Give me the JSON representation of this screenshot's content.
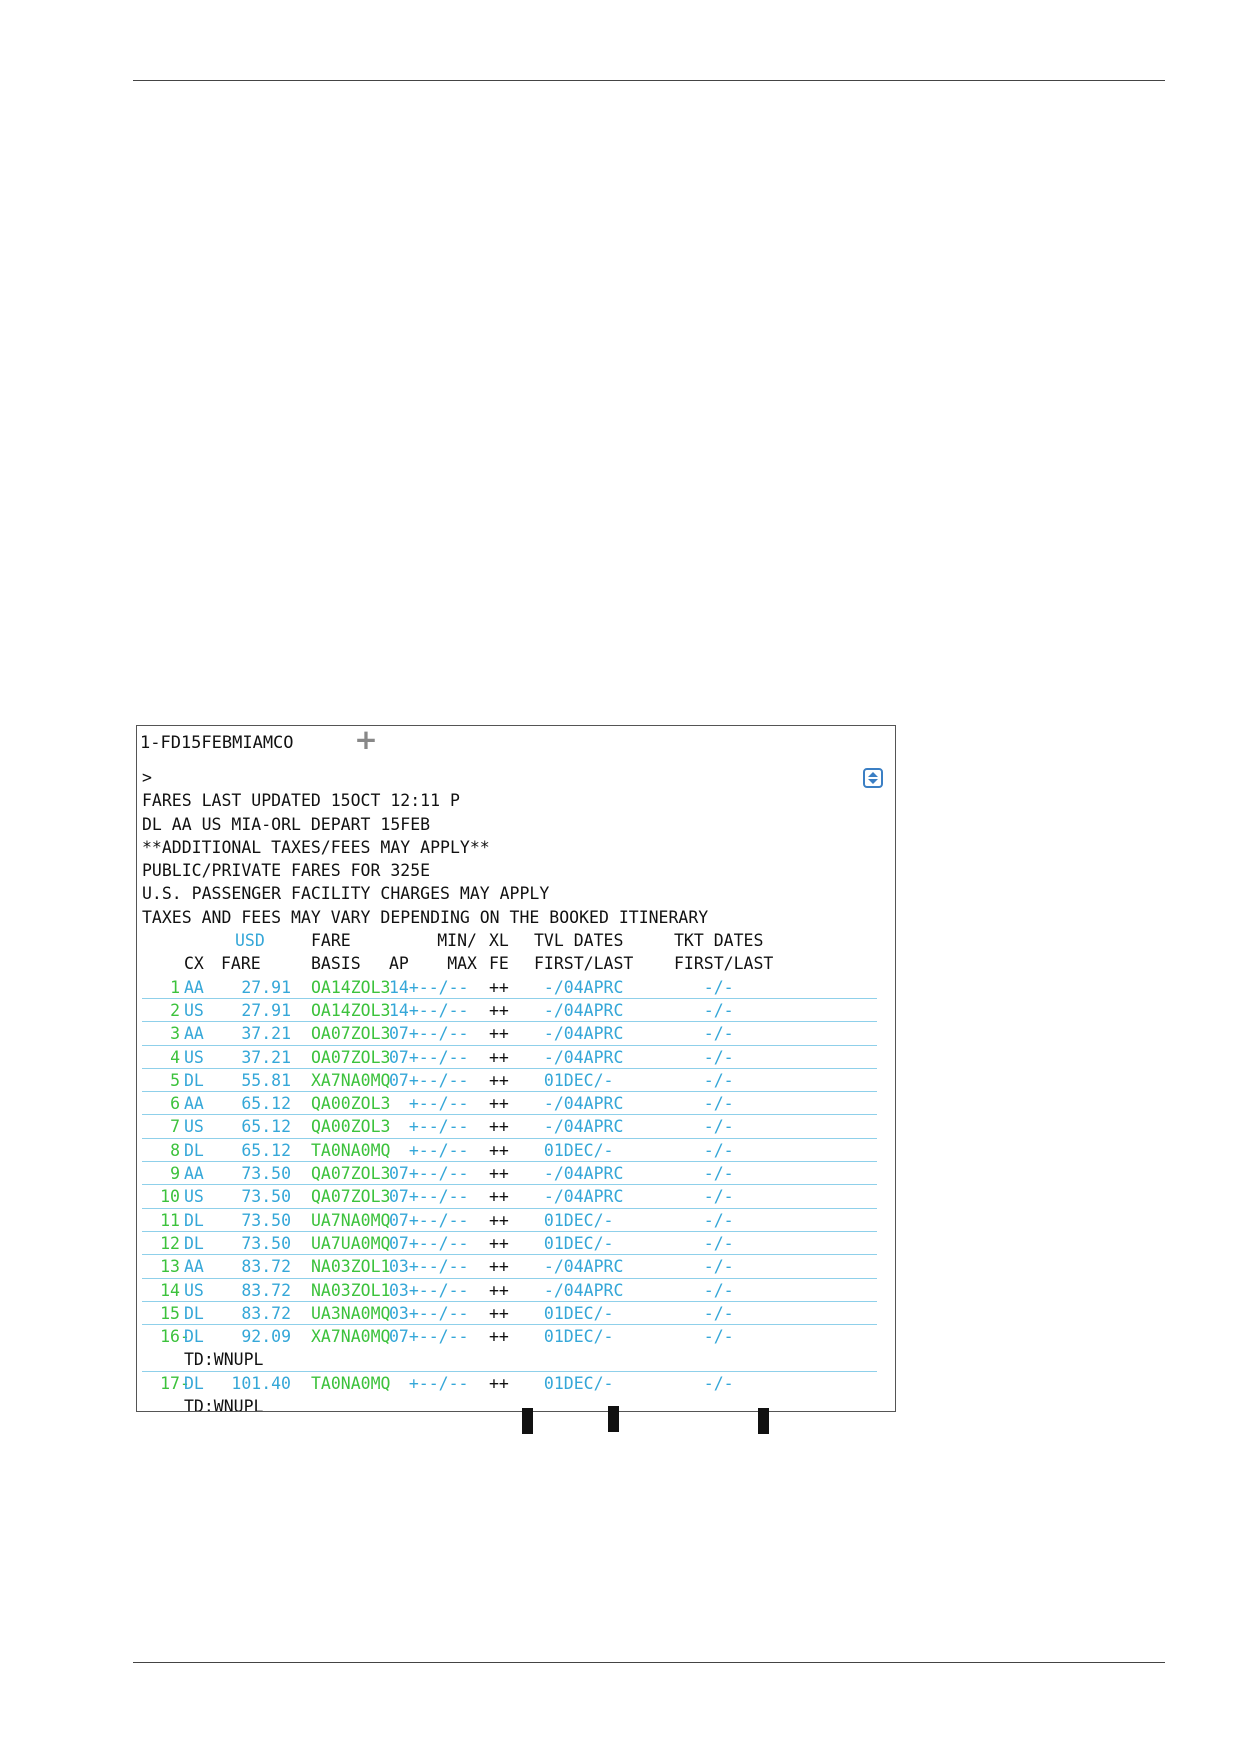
{
  "terminal": {
    "tab_label": "1-FD15FEBMIAMCO",
    "add_tab_symbol": "+",
    "prompt": ">",
    "message_lines": [
      "FARES LAST UPDATED 15OCT 12:11 P",
      "DL AA US MIA-ORL DEPART 15FEB",
      "**ADDITIONAL TAXES/FEES MAY APPLY**",
      "PUBLIC/PRIVATE FARES FOR 325E",
      "U.S. PASSENGER FACILITY CHARGES MAY APPLY",
      "TAXES AND FEES MAY VARY DEPENDING ON THE BOOKED ITINERARY"
    ],
    "header1": {
      "currency": "USD",
      "fare": "FARE",
      "min": "MIN/",
      "xl": "XL",
      "tvl": "TVL DATES",
      "tkt": "TKT DATES"
    },
    "header2": {
      "cx": "CX",
      "fare": "FARE",
      "basis": "BASIS",
      "ap": "AP",
      "max": "MAX",
      "fe": "FE",
      "tvl": "FIRST/LAST",
      "tkt": "FIRST/LAST"
    },
    "fares": [
      {
        "num": "1",
        "sep": " ",
        "cx": "AA",
        "fare": "27.91",
        "basis": "OA14ZOL3",
        "ap": "14+--/--",
        "xl": "++",
        "tvl": " -/04APRC",
        "tkt": "   -/-"
      },
      {
        "num": "2",
        "sep": " ",
        "cx": "US",
        "fare": "27.91",
        "basis": "OA14ZOL3",
        "ap": "14+--/--",
        "xl": "++",
        "tvl": " -/04APRC",
        "tkt": "   -/-"
      },
      {
        "num": "3",
        "sep": " ",
        "cx": "AA",
        "fare": "37.21",
        "basis": "OA07ZOL3",
        "ap": "07+--/--",
        "xl": "++",
        "tvl": " -/04APRC",
        "tkt": "   -/-"
      },
      {
        "num": "4",
        "sep": " ",
        "cx": "US",
        "fare": "37.21",
        "basis": "OA07ZOL3",
        "ap": "07+--/--",
        "xl": "++",
        "tvl": " -/04APRC",
        "tkt": "   -/-"
      },
      {
        "num": "5",
        "sep": " ",
        "cx": "DL",
        "fare": "55.81",
        "basis": "XA7NA0MQ",
        "ap": "07+--/--",
        "xl": "++",
        "tvl": " 01DEC/-",
        "tkt": "   -/-"
      },
      {
        "num": "6",
        "sep": " ",
        "cx": "AA",
        "fare": "65.12",
        "basis": "QA00ZOL3",
        "ap": "  +--/--",
        "xl": "++",
        "tvl": " -/04APRC",
        "tkt": "   -/-"
      },
      {
        "num": "7",
        "sep": " ",
        "cx": "US",
        "fare": "65.12",
        "basis": "QA00ZOL3",
        "ap": "  +--/--",
        "xl": "++",
        "tvl": " -/04APRC",
        "tkt": "   -/-"
      },
      {
        "num": "8",
        "sep": " ",
        "cx": "DL",
        "fare": "65.12",
        "basis": "TA0NA0MQ",
        "ap": "  +--/--",
        "xl": "++",
        "tvl": " 01DEC/-",
        "tkt": "   -/-"
      },
      {
        "num": "9",
        "sep": " ",
        "cx": "AA",
        "fare": "73.50",
        "basis": "QA07ZOL3",
        "ap": "07+--/--",
        "xl": "++",
        "tvl": " -/04APRC",
        "tkt": "   -/-"
      },
      {
        "num": "10",
        "sep": " ",
        "cx": "US",
        "fare": "73.50",
        "basis": "QA07ZOL3",
        "ap": "07+--/--",
        "xl": "++",
        "tvl": " -/04APRC",
        "tkt": "   -/-"
      },
      {
        "num": "11",
        "sep": " ",
        "cx": "DL",
        "fare": "73.50",
        "basis": "UA7NA0MQ",
        "ap": "07+--/--",
        "xl": "++",
        "tvl": " 01DEC/-",
        "tkt": "   -/-"
      },
      {
        "num": "12",
        "sep": " ",
        "cx": "DL",
        "fare": "73.50",
        "basis": "UA7UA0MQ",
        "ap": "07+--/--",
        "xl": "++",
        "tvl": " 01DEC/-",
        "tkt": "   -/-"
      },
      {
        "num": "13",
        "sep": " ",
        "cx": "AA",
        "fare": "83.72",
        "basis": "NA03ZOL1",
        "ap": "03+--/--",
        "xl": "++",
        "tvl": " -/04APRC",
        "tkt": "   -/-"
      },
      {
        "num": "14",
        "sep": " ",
        "cx": "US",
        "fare": "83.72",
        "basis": "NA03ZOL1",
        "ap": "03+--/--",
        "xl": "++",
        "tvl": " -/04APRC",
        "tkt": "   -/-"
      },
      {
        "num": "15",
        "sep": " ",
        "cx": "DL",
        "fare": "83.72",
        "basis": "UA3NA0MQ",
        "ap": "03+--/--",
        "xl": "++",
        "tvl": " 01DEC/-",
        "tkt": "   -/-"
      },
      {
        "num": "16",
        "sep": "-",
        "cx": "DL",
        "fare": "92.09",
        "basis": "XA7NA0MQ",
        "ap": "07+--/--",
        "xl": "++",
        "tvl": " 01DEC/-",
        "tkt": "   -/-",
        "td": "TD:WNUPL"
      },
      {
        "num": "17",
        "sep": "-",
        "cx": "DL",
        "fare": "101.40",
        "basis": "TA0NA0MQ",
        "ap": "  +--/--",
        "xl": "++",
        "tvl": " 01DEC/-",
        "tkt": "   -/-",
        "td": "TD:WNUPL"
      }
    ]
  },
  "colors": {
    "green": "#3cc23c",
    "blue": "#35a7d8",
    "row_rule": "#8fd0ea"
  }
}
